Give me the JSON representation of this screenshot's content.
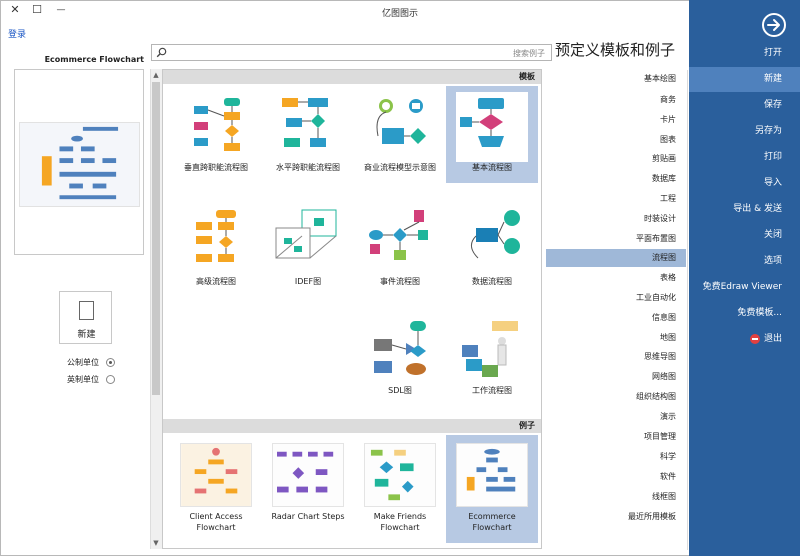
{
  "window": {
    "title": "亿图图示",
    "login": "登录",
    "close_glyph": "✕",
    "maximize_glyph": "☐",
    "minimize_glyph": "—"
  },
  "sidebar": {
    "items": [
      {
        "label": "打开",
        "active": false
      },
      {
        "label": "新建",
        "active": true
      },
      {
        "label": "保存",
        "active": false
      },
      {
        "label": "另存为",
        "active": false
      },
      {
        "label": "打印",
        "active": false
      },
      {
        "label": "导入",
        "active": false
      },
      {
        "label": "导出 & 发送",
        "active": false
      },
      {
        "label": "关闭",
        "active": false
      },
      {
        "label": "选项",
        "active": false
      },
      {
        "label": "免费Edraw Viewer",
        "active": false
      },
      {
        "label": "免费模板...",
        "active": false
      },
      {
        "label": "退出",
        "active": false
      }
    ]
  },
  "heading": "预定义模板和例子",
  "search": {
    "placeholder": "搜索例子"
  },
  "categories": [
    "基本绘图",
    "商务",
    "卡片",
    "图表",
    "剪贴画",
    "数据库",
    "工程",
    "时装设计",
    "平面布置图",
    "流程图",
    "表格",
    "工业自动化",
    "信息图",
    "地图",
    "思维导图",
    "网络图",
    "组织结构图",
    "演示",
    "项目管理",
    "科学",
    "软件",
    "线框图",
    "最近所用模板"
  ],
  "active_category": "流程图",
  "templates_section": "模板",
  "templates": [
    {
      "label": "基本流程图",
      "selected": true
    },
    {
      "label": "商业流程模型示意图",
      "selected": false
    },
    {
      "label": "水平跨职能流程图",
      "selected": false
    },
    {
      "label": "垂直跨职能流程图",
      "selected": false
    },
    {
      "label": "数据流程图",
      "selected": false
    },
    {
      "label": "事件流程图",
      "selected": false
    },
    {
      "label": "IDEF图",
      "selected": false
    },
    {
      "label": "高级流程图",
      "selected": false
    },
    {
      "label": "工作流程图",
      "selected": false
    },
    {
      "label": "SDL图",
      "selected": false
    }
  ],
  "examples_section": "例子",
  "examples": [
    {
      "line1": "Ecommerce",
      "line2": "Flowchart",
      "selected": true
    },
    {
      "line1": "Make Friends",
      "line2": "Flowchart",
      "selected": false
    },
    {
      "line1": "Radar Chart Steps",
      "line2": "",
      "selected": false
    },
    {
      "line1": "Client Access",
      "line2": "Flowchart",
      "selected": false
    }
  ],
  "preview": {
    "title": "Ecommerce Flowchart"
  },
  "new_button": "新建",
  "units": {
    "metric": "公制单位",
    "imperial": "英制单位",
    "selected": "metric"
  },
  "colors": {
    "sidebar": "#2a5f9c",
    "sidebar_active": "#4f81bd",
    "selection": "#b7c9e3",
    "link": "#1a56c4"
  }
}
